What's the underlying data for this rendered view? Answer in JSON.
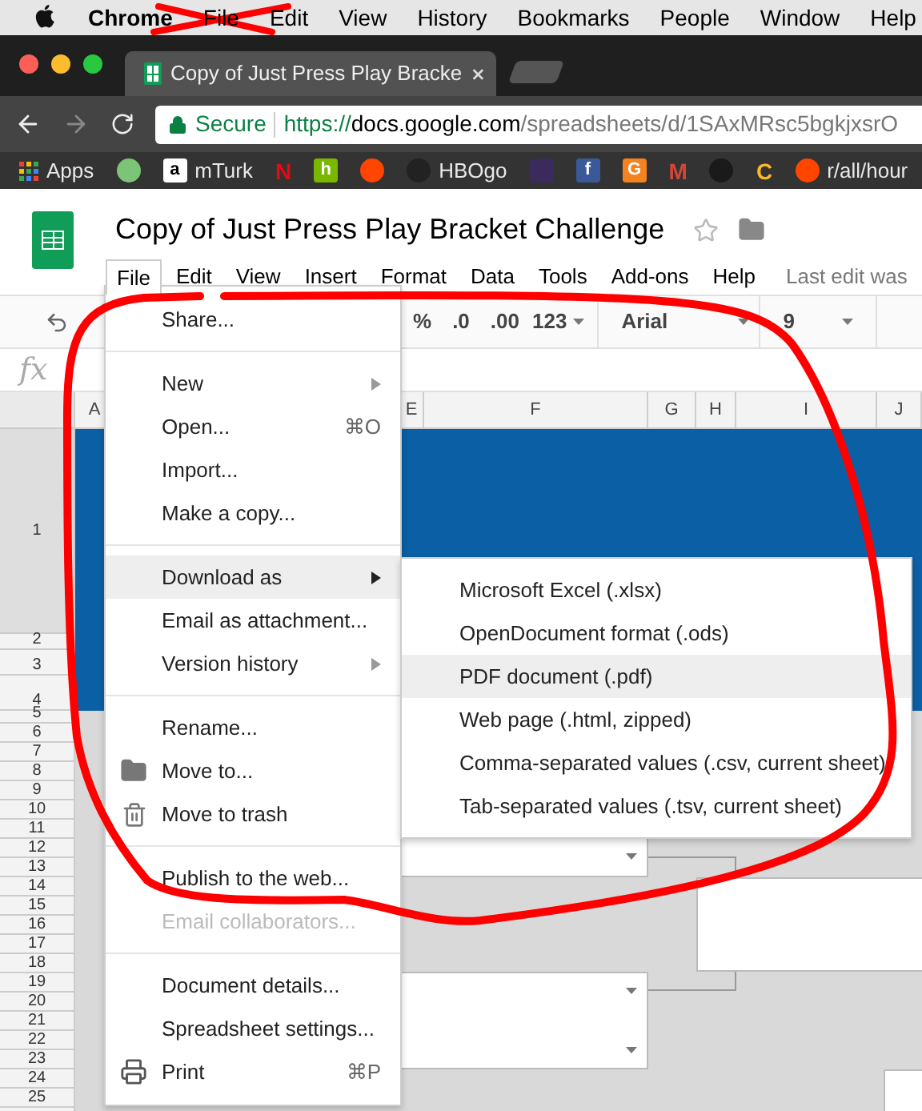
{
  "mac_menu": {
    "app_name": "Chrome",
    "items": [
      "File",
      "Edit",
      "View",
      "History",
      "Bookmarks",
      "People",
      "Window",
      "Help"
    ]
  },
  "browser": {
    "tab": {
      "title": "Copy of Just Press Play Bracke"
    },
    "address": {
      "secure_label": "Secure",
      "url_scheme": "https://",
      "url_host": "docs.google.com",
      "url_path": "/spreadsheets/d/1SAxMRsc5bgkjxsrO"
    },
    "bookmarks": [
      {
        "kind": "grid",
        "label": "Apps"
      },
      {
        "kind": "circle",
        "color": "#7cc576"
      },
      {
        "kind": "square",
        "color": "#ffffff",
        "glyph": "a",
        "label": "mTurk"
      },
      {
        "kind": "letter",
        "color": "#e50914",
        "glyph": "N"
      },
      {
        "kind": "square",
        "color": "#7ab800",
        "glyph": "h"
      },
      {
        "kind": "circle",
        "color": "#ff4500"
      },
      {
        "kind": "circle",
        "color": "#222222",
        "label": "HBOgo"
      },
      {
        "kind": "square",
        "color": "#3b2a5c"
      },
      {
        "kind": "square",
        "color": "#3b5998",
        "glyph": "f"
      },
      {
        "kind": "square",
        "color": "#f58220",
        "glyph": "G"
      },
      {
        "kind": "letter",
        "color": "#d44638",
        "glyph": "M"
      },
      {
        "kind": "circle",
        "color": "#1a1a1a"
      },
      {
        "kind": "letter",
        "color": "#fdb827",
        "glyph": "C"
      },
      {
        "kind": "circle",
        "color": "#ff4500",
        "label": "r/all/hour"
      }
    ]
  },
  "sheets": {
    "title": "Copy of Just Press Play Bracket Challenge",
    "menu": [
      {
        "label": "File",
        "selected": true
      },
      {
        "label": "Edit",
        "selected": false
      },
      {
        "label": "View",
        "selected": false
      },
      {
        "label": "Insert",
        "selected": false
      },
      {
        "label": "Format",
        "selected": false
      },
      {
        "label": "Data",
        "selected": false
      },
      {
        "label": "Tools",
        "selected": false
      },
      {
        "label": "Add-ons",
        "selected": false
      },
      {
        "label": "Help",
        "selected": false
      }
    ],
    "last_edit": "Last edit was",
    "toolbar": {
      "percent": "%",
      "decrease_decimal": ".0",
      "increase_decimal": ".00",
      "number_format": "123",
      "font": "Arial",
      "font_size": "9"
    },
    "formula_label": "fx",
    "grid": {
      "columns": [
        "A",
        "E",
        "F",
        "G",
        "H",
        "I",
        "J"
      ],
      "rows": [
        "1",
        "2",
        "3",
        "4",
        "5",
        "6",
        "7",
        "8",
        "9",
        "10",
        "11",
        "12",
        "13",
        "14",
        "15",
        "16",
        "17",
        "18",
        "19",
        "20",
        "21",
        "22",
        "23",
        "24",
        "25"
      ]
    }
  },
  "file_menu": {
    "sections": [
      [
        {
          "label": "Share...",
          "submenu": false,
          "selected": false,
          "disabled": false
        }
      ],
      [
        {
          "label": "New",
          "submenu": true,
          "selected": false,
          "disabled": false
        },
        {
          "label": "Open...",
          "shortcut": "⌘O",
          "submenu": false,
          "selected": false,
          "disabled": false
        },
        {
          "label": "Import...",
          "submenu": false,
          "selected": false,
          "disabled": false
        },
        {
          "label": "Make a copy...",
          "submenu": false,
          "selected": false,
          "disabled": false
        }
      ],
      [
        {
          "label": "Download as",
          "submenu": true,
          "selected": true,
          "disabled": false
        },
        {
          "label": "Email as attachment...",
          "submenu": false,
          "selected": false,
          "disabled": false
        },
        {
          "label": "Version history",
          "submenu": true,
          "selected": false,
          "disabled": false
        }
      ],
      [
        {
          "label": "Rename...",
          "submenu": false,
          "selected": false,
          "disabled": false
        },
        {
          "label": "Move to...",
          "submenu": false,
          "selected": false,
          "disabled": false
        },
        {
          "label": "Move to trash",
          "submenu": false,
          "selected": false,
          "disabled": false
        }
      ],
      [
        {
          "label": "Publish to the web...",
          "submenu": false,
          "selected": false,
          "disabled": false
        },
        {
          "label": "Email collaborators...",
          "submenu": false,
          "selected": false,
          "disabled": true
        }
      ],
      [
        {
          "label": "Document details...",
          "submenu": false,
          "selected": false,
          "disabled": false
        },
        {
          "label": "Spreadsheet settings...",
          "submenu": false,
          "selected": false,
          "disabled": false
        },
        {
          "label": "Print",
          "shortcut": "⌘P",
          "submenu": false,
          "selected": false,
          "disabled": false
        }
      ]
    ]
  },
  "download_submenu": {
    "items": [
      {
        "label": "Microsoft Excel (.xlsx)",
        "selected": false
      },
      {
        "label": "OpenDocument format (.ods)",
        "selected": false
      },
      {
        "label": "PDF document (.pdf)",
        "selected": true
      },
      {
        "label": "Web page (.html, zipped)",
        "selected": false
      },
      {
        "label": "Comma-separated values (.csv, current sheet)",
        "selected": false
      },
      {
        "label": "Tab-separated values (.tsv, current sheet)",
        "selected": false
      }
    ]
  }
}
